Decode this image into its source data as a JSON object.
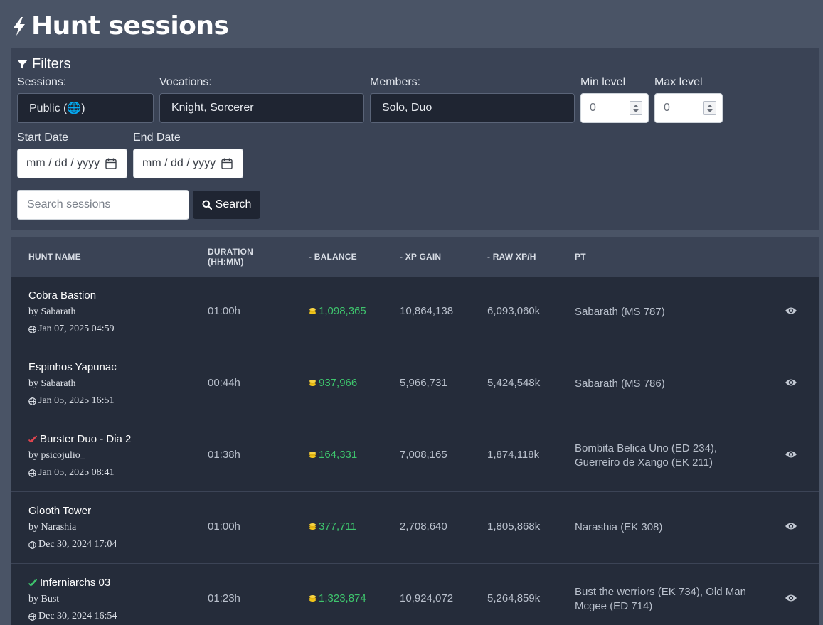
{
  "header": {
    "title": "Hunt sessions",
    "icon": "bolt-icon"
  },
  "filters": {
    "title": "Filters",
    "sessions": {
      "label": "Sessions:",
      "value": "Public (🌐)"
    },
    "vocations": {
      "label": "Vocations:",
      "value": "Knight, Sorcerer"
    },
    "members": {
      "label": "Members:",
      "value": "Solo, Duo"
    },
    "min_level": {
      "label": "Min level",
      "value": "0"
    },
    "max_level": {
      "label": "Max level",
      "value": "0"
    },
    "start_date": {
      "label": "Start Date",
      "value": "mm / dd / yyyy"
    },
    "end_date": {
      "label": "End Date",
      "value": "mm / dd / yyyy"
    },
    "search": {
      "placeholder": "Search sessions",
      "button_label": "Search"
    }
  },
  "table": {
    "columns": {
      "hunt_name": "HUNT NAME",
      "duration_1": "DURATION",
      "duration_2": "(HH:MM)",
      "balance": "- BALANCE",
      "xp_gain": "- XP GAIN",
      "raw_xph": "- RAW XP/H",
      "pt": "PT"
    },
    "rows": [
      {
        "name": "Cobra Bastion",
        "by": "by Sabarath",
        "date": "Jan 07, 2025 04:59",
        "duration": "01:00h",
        "balance": "1,098,365",
        "xp_gain": "10,864,138",
        "raw_xph": "6,093,060k",
        "pt_1": "Sabarath (MS 787)",
        "pt_2": "",
        "check": "none"
      },
      {
        "name": "Espinhos Yapunac",
        "by": "by Sabarath",
        "date": "Jan 05, 2025 16:51",
        "duration": "00:44h",
        "balance": "937,966",
        "xp_gain": "5,966,731",
        "raw_xph": "5,424,548k",
        "pt_1": "Sabarath (MS 786)",
        "pt_2": "",
        "check": "none"
      },
      {
        "name": "Burster Duo - Dia 2",
        "by": "by psicojulio_",
        "date": "Jan 05, 2025 08:41",
        "duration": "01:38h",
        "balance": "164,331",
        "xp_gain": "7,008,165",
        "raw_xph": "1,874,118k",
        "pt_1": "Bombita Belica Uno (ED 234),",
        "pt_2": "Guerreiro de Xango (EK 211)",
        "check": "red"
      },
      {
        "name": "Glooth Tower",
        "by": "by Narashia",
        "date": "Dec 30, 2024 17:04",
        "duration": "01:00h",
        "balance": "377,711",
        "xp_gain": "2,708,640",
        "raw_xph": "1,805,868k",
        "pt_1": "Narashia (EK 308)",
        "pt_2": "",
        "check": "none"
      },
      {
        "name": "Inferniarchs 03",
        "by": "by Bust",
        "date": "Dec 30, 2024 16:54",
        "duration": "01:23h",
        "balance": "1,323,874",
        "xp_gain": "10,924,072",
        "raw_xph": "5,264,859k",
        "pt_1": "Bust the werriors (EK 734), Old Man",
        "pt_2": "Mcgee (ED 714)",
        "check": "green"
      }
    ]
  },
  "colors": {
    "page_bg": "#4a5466",
    "panel_bg": "#3a4355",
    "row_bg": "#252c3a",
    "balance_green": "#3ec46d",
    "coin_yellow": "#f2c519",
    "check_red": "#e0454f",
    "check_green": "#3ec46d"
  }
}
